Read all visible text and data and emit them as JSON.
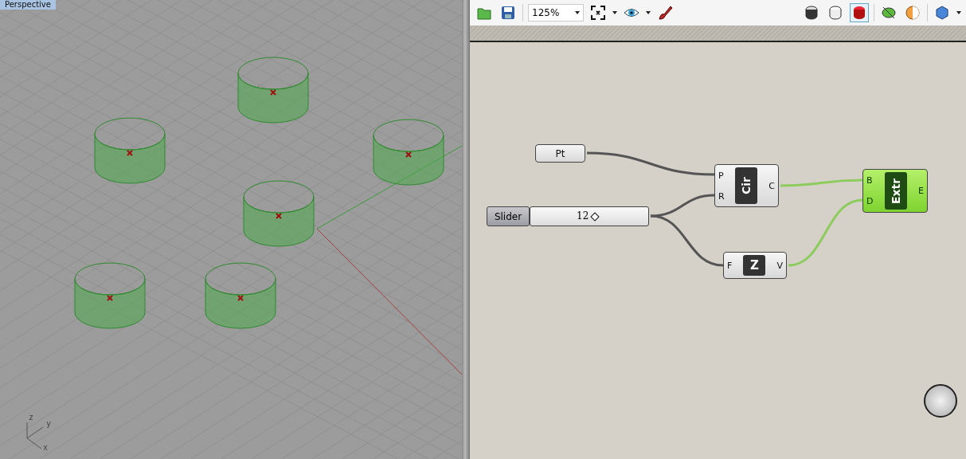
{
  "viewport": {
    "label": "Perspective",
    "axes": [
      "z",
      "y",
      "x"
    ]
  },
  "toolbar": {
    "zoom": "125%",
    "preview_modes": [
      {
        "selected": false
      },
      {
        "selected": false
      },
      {
        "selected": true
      }
    ]
  },
  "canvas": {
    "nodes": [
      {
        "kind": "param",
        "label": "Pt",
        "selected": false
      },
      {
        "kind": "slider",
        "label": "Slider",
        "value": "12",
        "level": 0.55,
        "selected": false
      },
      {
        "kind": "component",
        "label": "Cir",
        "inputs": [
          "P",
          "R"
        ],
        "outputs": [
          "C"
        ],
        "selected": false
      },
      {
        "kind": "component",
        "label": "Z",
        "inputs": [
          "F"
        ],
        "outputs": [
          "V"
        ],
        "selected": false
      },
      {
        "kind": "component",
        "label": "Extr",
        "inputs": [
          "B",
          "D"
        ],
        "outputs": [
          "E"
        ],
        "selected": true
      }
    ]
  }
}
